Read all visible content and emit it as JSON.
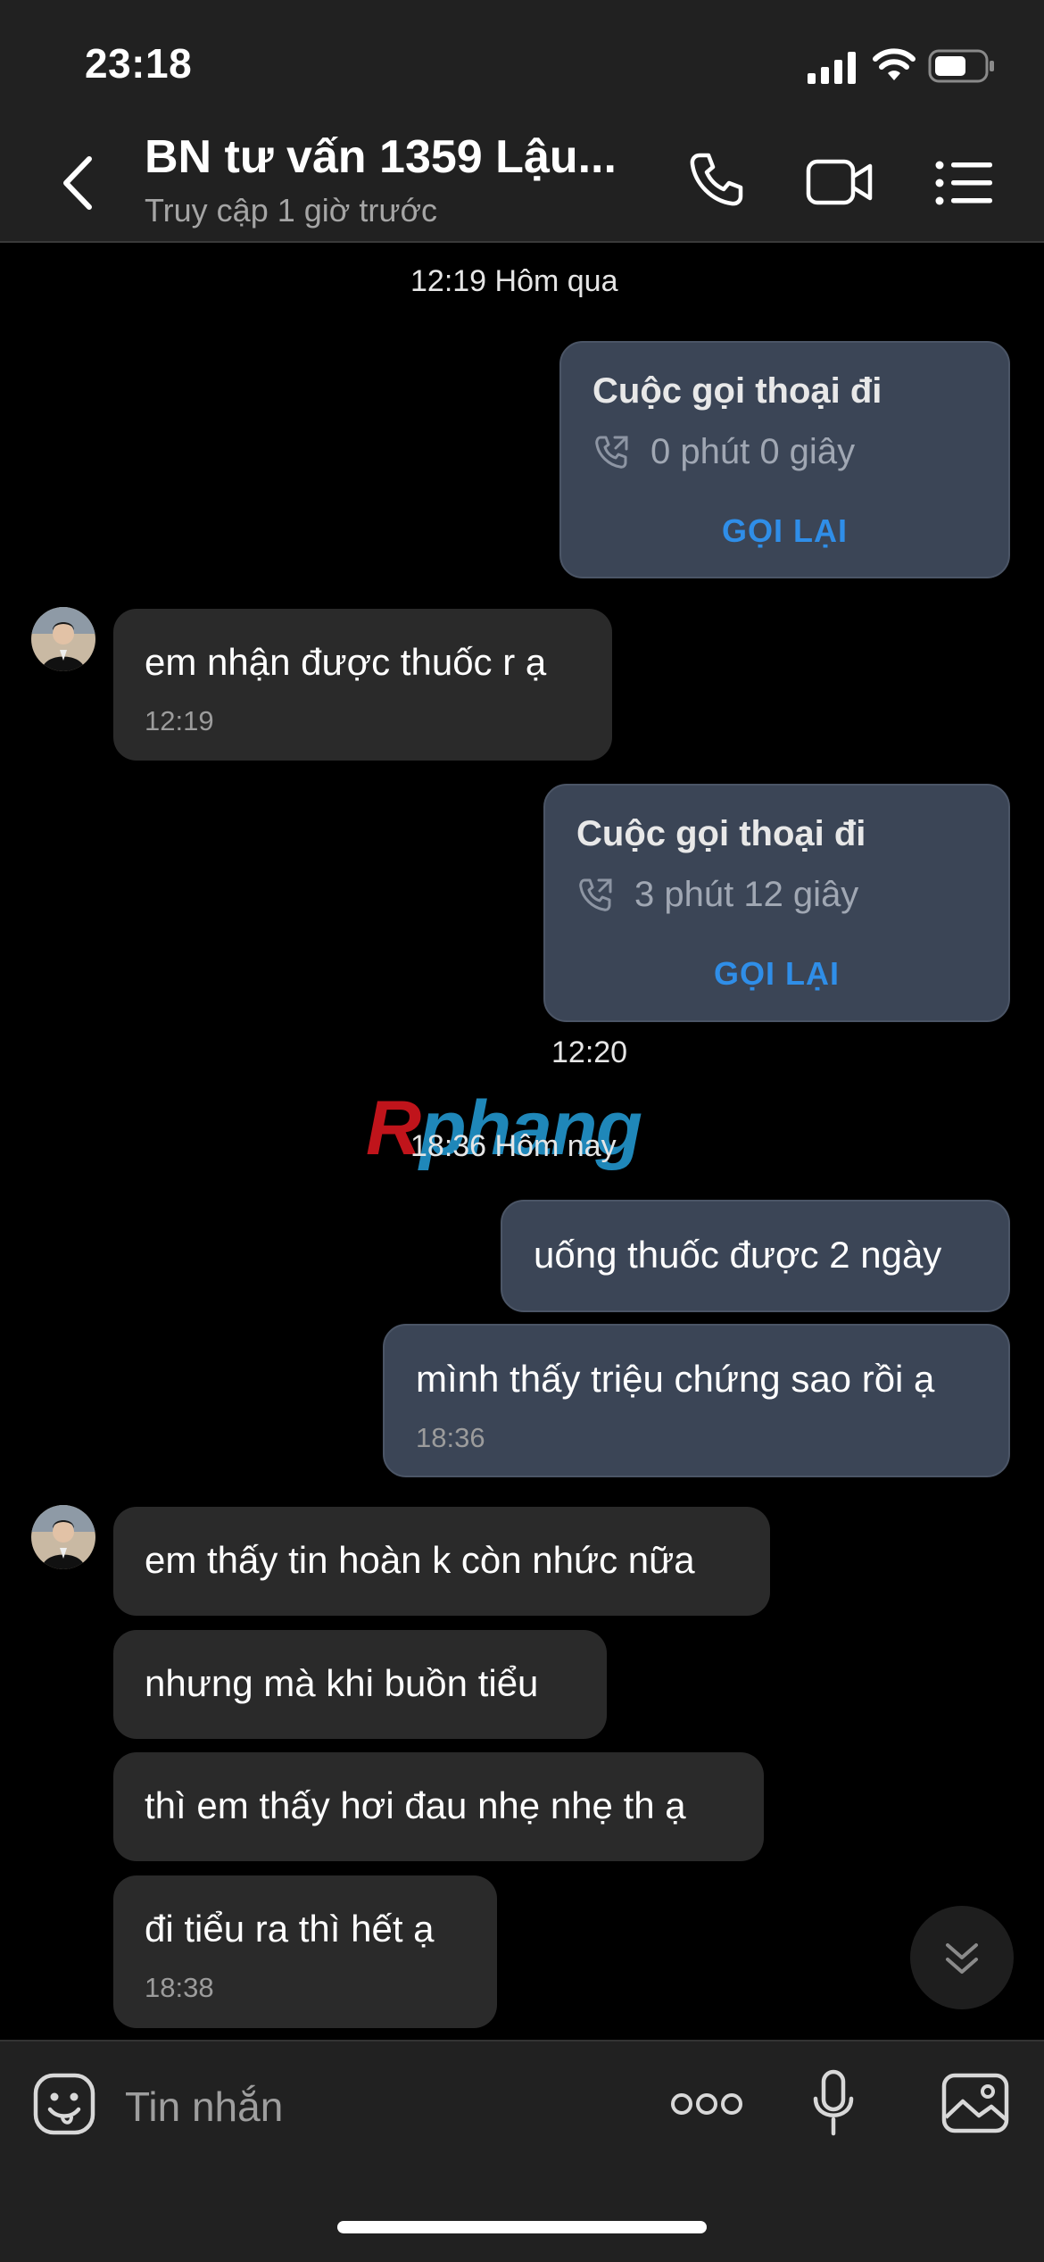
{
  "status_bar": {
    "time": "23:18"
  },
  "header": {
    "title": "BN tư vấn 1359 Lậu...",
    "subtitle": "Truy cập 1 giờ trước"
  },
  "messages": {
    "ts1": "12:19 Hôm qua",
    "call1": {
      "title": "Cuộc gọi thoại đi",
      "duration": "0 phút 0 giây",
      "action": "GỌI LẠI"
    },
    "in1": {
      "text": "em nhận được thuốc r ạ",
      "time": "12:19"
    },
    "call2": {
      "title": "Cuộc gọi thoại đi",
      "duration": "3 phút 12 giây",
      "action": "GỌI LẠI"
    },
    "ts2": "12:20",
    "ts3": "18:36 Hôm nay",
    "out1": {
      "text": "uống thuốc được 2 ngày"
    },
    "out2": {
      "text": "mình thấy triệu chứng sao rồi ạ",
      "time": "18:36"
    },
    "in2": {
      "text": "em thấy tin hoàn k còn nhức nữa"
    },
    "in3": {
      "text": "nhưng mà khi buồn tiểu"
    },
    "in4": {
      "text": "thì em thấy hơi đau nhẹ nhẹ th ạ"
    },
    "in5": {
      "text": "đi tiểu ra thì hết ạ",
      "time": "18:38"
    }
  },
  "watermark": {
    "text_part1": "R",
    "text_part2": "phang"
  },
  "composer": {
    "placeholder": "Tin nhắn"
  },
  "colors": {
    "accent": "#2f8ee8",
    "outgoing_bubble": "#3b4556",
    "incoming_bubble": "#2a2a2a",
    "header_bg": "#212121"
  }
}
